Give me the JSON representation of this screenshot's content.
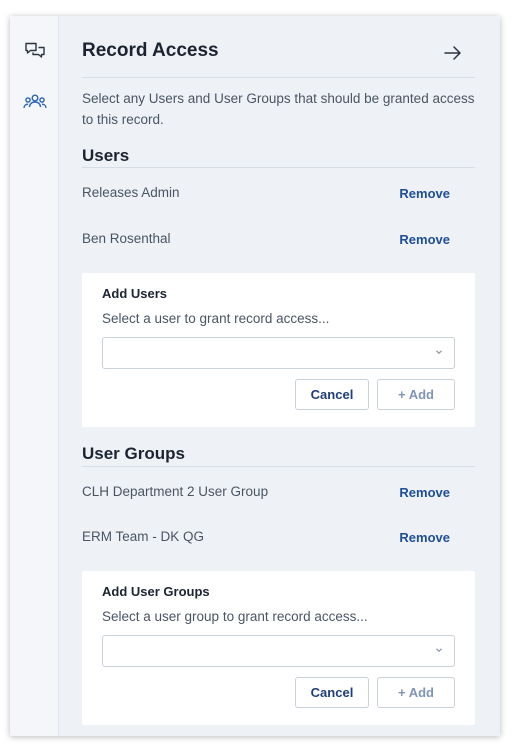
{
  "header": {
    "title": "Record Access"
  },
  "description": "Select any Users and User Groups that should be granted access to this record.",
  "users": {
    "title": "Users",
    "items": [
      {
        "name": "Releases Admin",
        "action": "Remove"
      },
      {
        "name": "Ben Rosenthal",
        "action": "Remove"
      }
    ],
    "add_card": {
      "title": "Add Users",
      "subtitle": "Select a user to grant record access...",
      "select_value": "",
      "cancel_label": "Cancel",
      "add_label": "+ Add"
    }
  },
  "user_groups": {
    "title": "User Groups",
    "items": [
      {
        "name": "CLH Department 2 User Group",
        "action": "Remove"
      },
      {
        "name": "ERM Team - DK QG",
        "action": "Remove"
      }
    ],
    "add_card": {
      "title": "Add User Groups",
      "subtitle": "Select a user group to grant record access...",
      "select_value": "",
      "cancel_label": "Cancel",
      "add_label": "+ Add"
    }
  },
  "rail": {
    "icons": [
      "comments-icon",
      "users-icon"
    ]
  },
  "colors": {
    "accent": "#1f4e99",
    "panel_bg": "#eef2f6",
    "card_bg": "#ffffff"
  }
}
